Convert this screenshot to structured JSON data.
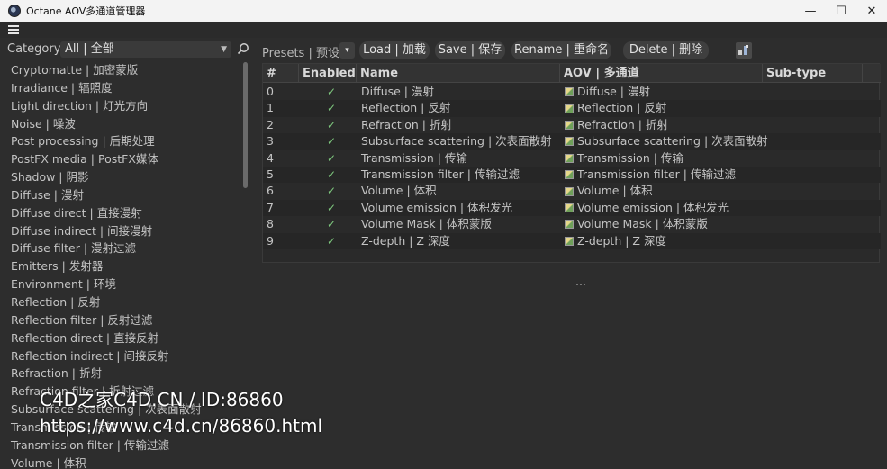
{
  "window": {
    "title": "Octane AOV多通道管理器",
    "controls": {
      "minimize": "—",
      "maximize": "☐",
      "close": "✕"
    }
  },
  "category": {
    "label": "Category",
    "selected": "All | 全部",
    "items": [
      "Cryptomatte | 加密蒙版",
      "Irradiance | 辐照度",
      "Light direction | 灯光方向",
      "Noise | 噪波",
      "Post processing | 后期处理",
      "PostFX media | PostFX媒体",
      "Shadow | 阴影",
      "Diffuse | 漫射",
      "Diffuse direct | 直接漫射",
      "Diffuse indirect | 间接漫射",
      "Diffuse filter | 漫射过滤",
      "Emitters | 发射器",
      "Environment | 环境",
      "Reflection | 反射",
      "Reflection filter | 反射过滤",
      "Reflection direct | 直接反射",
      "Reflection indirect | 间接反射",
      "Refraction | 折射",
      "Refraction filter | 折射过滤",
      "Subsurface scattering | 次表面散射",
      "Transmission | 传输",
      "Transmission filter | 传输过滤",
      "Volume | 体积"
    ]
  },
  "toolbar": {
    "presets_label": "Presets | 预设",
    "presets_caret": "▾",
    "load": "Load | 加载",
    "save": "Save | 保存",
    "rename": "Rename | 重命名",
    "delete": "Delete | 删除"
  },
  "table": {
    "headers": {
      "num": "#",
      "enabled": "Enabled",
      "name": "Name",
      "aov": "AOV | 多通道",
      "subtype": "Sub-type"
    },
    "rows": [
      {
        "num": "0",
        "enabled": "✓",
        "name": "Diffuse | 漫射",
        "aov": "Diffuse | 漫射"
      },
      {
        "num": "1",
        "enabled": "✓",
        "name": "Reflection | 反射",
        "aov": "Reflection | 反射"
      },
      {
        "num": "2",
        "enabled": "✓",
        "name": "Refraction | 折射",
        "aov": "Refraction | 折射"
      },
      {
        "num": "3",
        "enabled": "✓",
        "name": "Subsurface scattering | 次表面散射",
        "aov": "Subsurface scattering | 次表面散射"
      },
      {
        "num": "4",
        "enabled": "✓",
        "name": "Transmission | 传输",
        "aov": "Transmission | 传输"
      },
      {
        "num": "5",
        "enabled": "✓",
        "name": "Transmission filter | 传输过滤",
        "aov": "Transmission filter | 传输过滤"
      },
      {
        "num": "6",
        "enabled": "✓",
        "name": "Volume | 体积",
        "aov": "Volume | 体积"
      },
      {
        "num": "7",
        "enabled": "✓",
        "name": "Volume emission | 体积发光",
        "aov": "Volume emission | 体积发光"
      },
      {
        "num": "8",
        "enabled": "✓",
        "name": "Volume Mask | 体积蒙版",
        "aov": "Volume Mask | 体积蒙版"
      },
      {
        "num": "9",
        "enabled": "✓",
        "name": "Z-depth | Z 深度",
        "aov": "Z-depth | Z 深度"
      }
    ]
  },
  "watermark": {
    "line1": "C4D之家C4D.CN / ID:86860",
    "line2": "https://www.c4d.cn/86860.html"
  },
  "icons": {
    "app": "octane-app-icon",
    "menu": "hamburger-menu-icon",
    "search": "search-icon",
    "aov_swatch": "aov-swatch-icon",
    "add_aov": "aov-toggle-icon"
  }
}
